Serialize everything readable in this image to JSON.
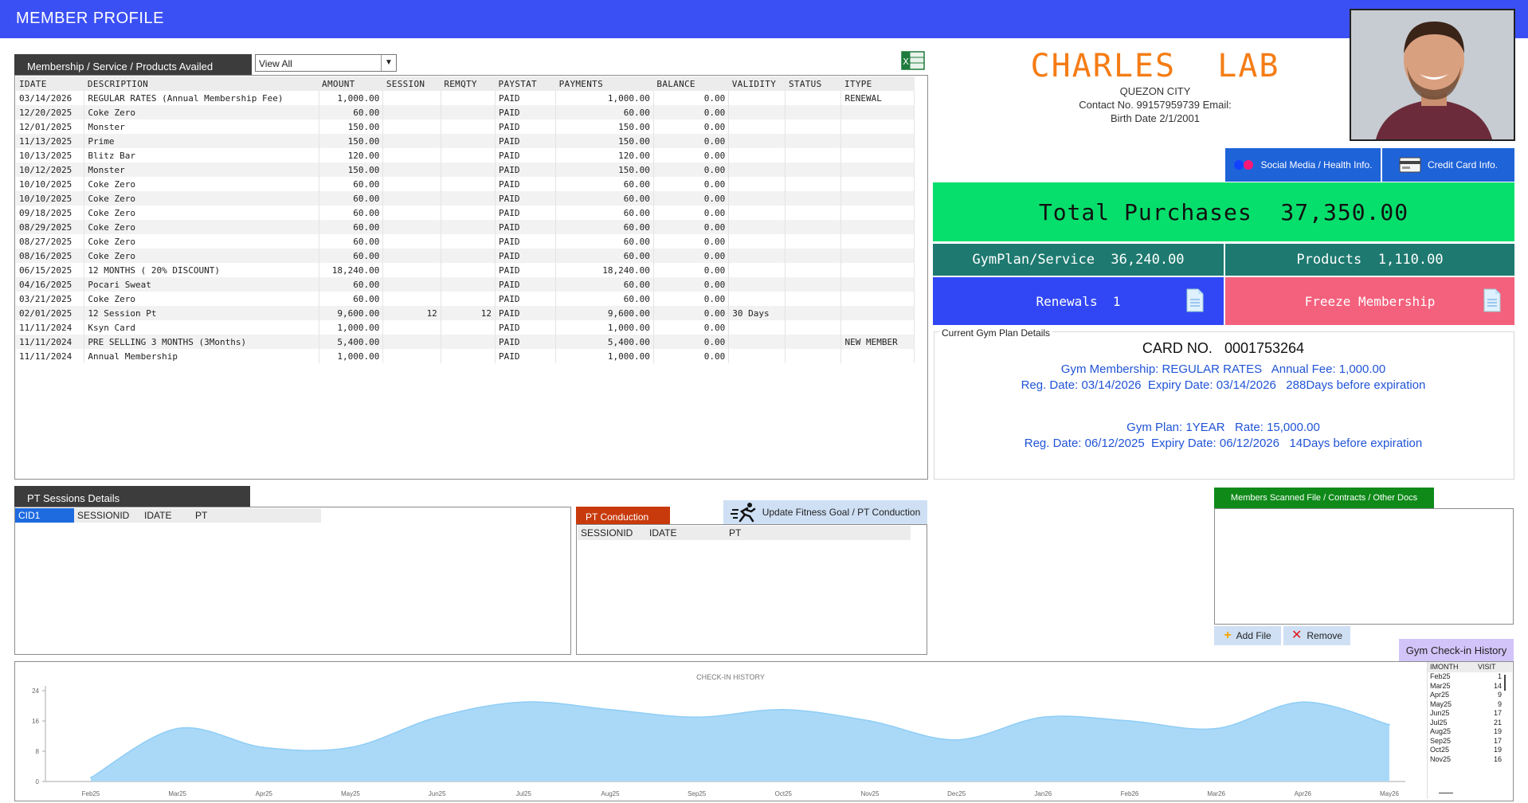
{
  "header": {
    "title": "MEMBER PROFILE"
  },
  "membership": {
    "tab_label": "Membership / Service / Products Availed",
    "filter_value": "View All",
    "columns": [
      "IDATE",
      "DESCRIPTION",
      "AMOUNT",
      "SESSION",
      "REMQTY",
      "PAYSTAT",
      "PAYMENTS",
      "BALANCE",
      "VALIDITY",
      "STATUS",
      "ITYPE"
    ],
    "rows": [
      [
        "03/14/2026",
        "REGULAR RATES (Annual Membership Fee)",
        "1,000.00",
        "",
        "",
        "PAID",
        "1,000.00",
        "0.00",
        "",
        "",
        "RENEWAL"
      ],
      [
        "12/20/2025",
        "Coke Zero",
        "60.00",
        "",
        "",
        "PAID",
        "60.00",
        "0.00",
        "",
        "",
        ""
      ],
      [
        "12/01/2025",
        "Monster",
        "150.00",
        "",
        "",
        "PAID",
        "150.00",
        "0.00",
        "",
        "",
        ""
      ],
      [
        "11/13/2025",
        "Prime",
        "150.00",
        "",
        "",
        "PAID",
        "150.00",
        "0.00",
        "",
        "",
        ""
      ],
      [
        "10/13/2025",
        "Blitz Bar",
        "120.00",
        "",
        "",
        "PAID",
        "120.00",
        "0.00",
        "",
        "",
        ""
      ],
      [
        "10/12/2025",
        "Monster",
        "150.00",
        "",
        "",
        "PAID",
        "150.00",
        "0.00",
        "",
        "",
        ""
      ],
      [
        "10/10/2025",
        "Coke Zero",
        "60.00",
        "",
        "",
        "PAID",
        "60.00",
        "0.00",
        "",
        "",
        ""
      ],
      [
        "10/10/2025",
        "Coke Zero",
        "60.00",
        "",
        "",
        "PAID",
        "60.00",
        "0.00",
        "",
        "",
        ""
      ],
      [
        "09/18/2025",
        "Coke Zero",
        "60.00",
        "",
        "",
        "PAID",
        "60.00",
        "0.00",
        "",
        "",
        ""
      ],
      [
        "08/29/2025",
        "Coke Zero",
        "60.00",
        "",
        "",
        "PAID",
        "60.00",
        "0.00",
        "",
        "",
        ""
      ],
      [
        "08/27/2025",
        "Coke Zero",
        "60.00",
        "",
        "",
        "PAID",
        "60.00",
        "0.00",
        "",
        "",
        ""
      ],
      [
        "08/16/2025",
        "Coke Zero",
        "60.00",
        "",
        "",
        "PAID",
        "60.00",
        "0.00",
        "",
        "",
        ""
      ],
      [
        "06/15/2025",
        "12 MONTHS ( 20% DISCOUNT)",
        "18,240.00",
        "",
        "",
        "PAID",
        "18,240.00",
        "0.00",
        "",
        "",
        ""
      ],
      [
        "04/16/2025",
        "Pocari Sweat",
        "60.00",
        "",
        "",
        "PAID",
        "60.00",
        "0.00",
        "",
        "",
        ""
      ],
      [
        "03/21/2025",
        "Coke Zero",
        "60.00",
        "",
        "",
        "PAID",
        "60.00",
        "0.00",
        "",
        "",
        ""
      ],
      [
        "02/01/2025",
        "12 Session Pt",
        "9,600.00",
        "12",
        "12",
        "PAID",
        "9,600.00",
        "0.00",
        "30 Days",
        "",
        ""
      ],
      [
        "11/11/2024",
        "Ksyn Card",
        "1,000.00",
        "",
        "",
        "PAID",
        "1,000.00",
        "0.00",
        "",
        "",
        ""
      ],
      [
        "11/11/2024",
        "PRE SELLING  3 MONTHS (3Months)",
        "5,400.00",
        "",
        "",
        "PAID",
        "5,400.00",
        "0.00",
        "",
        "",
        "NEW MEMBER"
      ],
      [
        "11/11/2024",
        "Annual Membership",
        "1,000.00",
        "",
        "",
        "PAID",
        "1,000.00",
        "0.00",
        "",
        "",
        ""
      ]
    ]
  },
  "profile": {
    "first_name": "CHARLES",
    "last_name": "LAB",
    "city": "QUEZON CITY",
    "contact": "Contact No. 99157959739  Email:",
    "birth_date": "Birth Date  2/1/2001",
    "social_tab": "Social Media / Health Info.",
    "credit_tab": "Credit Card Info.",
    "total_purchases": "Total Purchases  37,350.00",
    "gymplan": "GymPlan/Service  36,240.00",
    "products": "Products  1,110.00",
    "renewals": "Renewals  1",
    "freeze": "Freeze Membership",
    "colors": {
      "accent_orange": "#f57c14",
      "total_green": "#07df6c",
      "teal": "#1e7a70",
      "renew_blue": "#3147f5",
      "freeze_pink": "#f4617d"
    }
  },
  "gym_plan": {
    "label": "Current Gym Plan Details",
    "card_label": "CARD NO.",
    "card_no": "0001753264",
    "membership_line": "Gym Membership: REGULAR RATES   Annual Fee: 1,000.00",
    "membership_dates": "Reg. Date: 03/14/2026  Expiry Date: 03/14/2026   288Days before expiration",
    "plan_line": "Gym Plan: 1YEAR   Rate: 15,000.00",
    "plan_dates": "Reg. Date: 06/12/2025  Expiry Date: 06/12/2026   14Days before expiration"
  },
  "pt_sessions": {
    "tab_label": "PT Sessions Details",
    "columns": [
      "CID1",
      "SESSIONID",
      "IDATE",
      "PT"
    ]
  },
  "pt_conduction": {
    "tab_label": "PT Conduction",
    "update_button": "Update Fitness Goal / PT Conduction",
    "columns": [
      "SESSIONID",
      "IDATE",
      "PT"
    ]
  },
  "docs": {
    "tab_label": "Members Scanned File / Contracts / Other Docs",
    "add_button": "Add File",
    "remove_button": "Remove"
  },
  "checkin": {
    "tab_label": "Gym Check-in History",
    "columns": [
      "IMONTH",
      "VISIT"
    ],
    "rows": [
      [
        "Feb25",
        "1"
      ],
      [
        "Mar25",
        "14"
      ],
      [
        "Apr25",
        "9"
      ],
      [
        "May25",
        "9"
      ],
      [
        "Jun25",
        "17"
      ],
      [
        "Jul25",
        "21"
      ],
      [
        "Aug25",
        "19"
      ],
      [
        "Sep25",
        "17"
      ],
      [
        "Oct25",
        "19"
      ],
      [
        "Nov25",
        "16"
      ]
    ]
  },
  "chart_data": {
    "type": "area",
    "title": "CHECK-IN HISTORY",
    "categories": [
      "Feb25",
      "Mar25",
      "Apr25",
      "May25",
      "Jun25",
      "Jul25",
      "Aug25",
      "Sep25",
      "Oct25",
      "Nov25",
      "Dec25",
      "Jan26",
      "Feb26",
      "Mar26",
      "Apr26",
      "May26"
    ],
    "values": [
      1,
      14,
      9,
      9,
      17,
      21,
      19,
      17,
      19,
      16,
      11,
      17,
      16,
      14,
      21,
      15
    ],
    "yticks": [
      0,
      8,
      16,
      24
    ],
    "ylim": [
      0,
      24
    ],
    "color": "#aad9f8"
  }
}
